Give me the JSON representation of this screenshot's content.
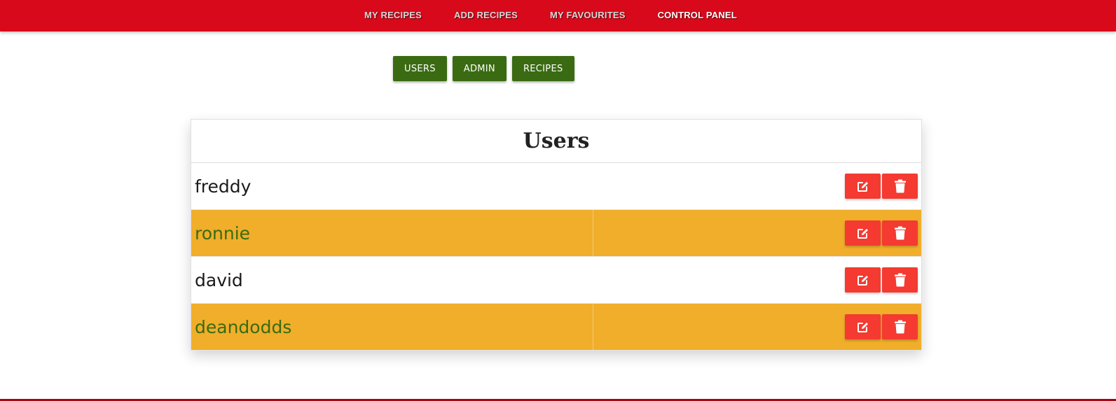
{
  "nav": {
    "links": [
      {
        "label": "MY RECIPES",
        "active": false
      },
      {
        "label": "ADD RECIPES",
        "active": false
      },
      {
        "label": "MY FAVOURITES",
        "active": false
      },
      {
        "label": "CONTROL PANEL",
        "active": true
      }
    ]
  },
  "subnav": {
    "users_label": "USERS",
    "admin_label": "ADMIN",
    "recipes_label": "RECIPES"
  },
  "panel": {
    "title": "Users",
    "users": [
      {
        "name": "freddy",
        "highlighted": false,
        "edit_icon": "edit-icon",
        "delete_icon": "trash-icon"
      },
      {
        "name": "ronnie",
        "highlighted": true,
        "edit_icon": "edit-icon",
        "delete_icon": "trash-icon"
      },
      {
        "name": "david",
        "highlighted": false,
        "edit_icon": "edit-icon",
        "delete_icon": "trash-icon"
      },
      {
        "name": "deandodds",
        "highlighted": true,
        "edit_icon": "edit-icon",
        "delete_icon": "trash-icon"
      }
    ]
  },
  "colors": {
    "navbar": "#d8091a",
    "button_green": "#3a6b12",
    "row_highlight": "#f0ae2a",
    "action_red": "#f43a31"
  }
}
